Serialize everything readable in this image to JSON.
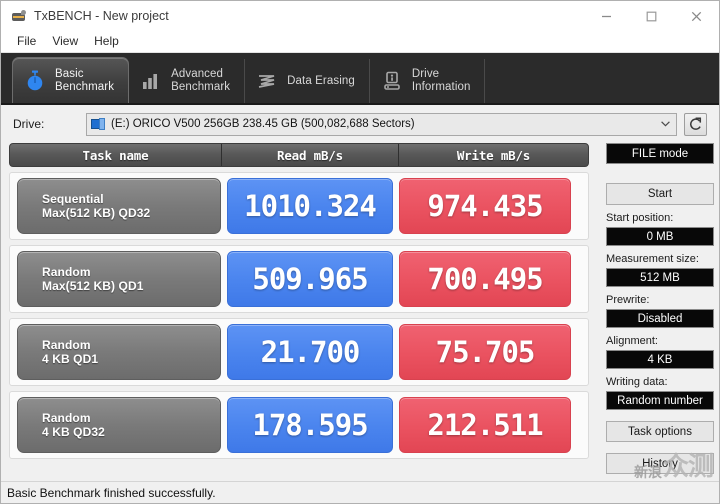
{
  "window": {
    "title": "TxBENCH - New project",
    "app_icon": "txbench-app-icon",
    "minimize_label": "Minimize",
    "maximize_label": "Maximize",
    "close_label": "Close"
  },
  "menubar": {
    "items": [
      {
        "label": "File"
      },
      {
        "label": "View"
      },
      {
        "label": "Help"
      }
    ]
  },
  "tabs": [
    {
      "label": "Basic\nBenchmark",
      "icon": "stopwatch-icon",
      "active": true
    },
    {
      "label": "Advanced\nBenchmark",
      "icon": "bar-chart-icon",
      "active": false
    },
    {
      "label": "Data Erasing",
      "icon": "eraser-waves-icon",
      "active": false
    },
    {
      "label": "Drive\nInformation",
      "icon": "drive-info-icon",
      "active": false
    }
  ],
  "drive": {
    "label": "Drive:",
    "value": "(E:) ORICO V500 256GB  238.45 GB (500,082,688 Sectors)",
    "disk_icon": "disk-drive-icon",
    "dropdown_icon": "chevron-down-icon",
    "refresh_icon": "refresh-icon"
  },
  "results": {
    "columns": [
      "Task name",
      "Read mB/s",
      "Write mB/s"
    ],
    "rows": [
      {
        "task_line1": "Sequential",
        "task_line2": "Max(512 KB) QD32",
        "read": "1010.324",
        "write": "974.435"
      },
      {
        "task_line1": "Random",
        "task_line2": "Max(512 KB) QD1",
        "read": "509.965",
        "write": "700.495"
      },
      {
        "task_line1": "Random",
        "task_line2": "4 KB QD1",
        "read": "21.700",
        "write": "75.705"
      },
      {
        "task_line1": "Random",
        "task_line2": "4 KB QD32",
        "read": "178.595",
        "write": "212.511"
      }
    ]
  },
  "sidebar": {
    "mode_button": "FILE mode",
    "start_button": "Start",
    "fields": [
      {
        "label": "Start position:",
        "value": "0 MB"
      },
      {
        "label": "Measurement size:",
        "value": "512 MB"
      },
      {
        "label": "Prewrite:",
        "value": "Disabled"
      },
      {
        "label": "Alignment:",
        "value": "4 KB"
      },
      {
        "label": "Writing data:",
        "value": "Random number"
      }
    ],
    "task_options_button": "Task options",
    "history_button": "History"
  },
  "statusbar": {
    "text": "Basic Benchmark finished successfully."
  },
  "watermark": {
    "small": "新浪",
    "big": "众测"
  },
  "colors": {
    "read_accent": "#4a84ee",
    "write_accent": "#ea5260",
    "tab_strip": "#2b2b2b",
    "task_cell": "#7a7a7a",
    "field_background": "#080808"
  }
}
